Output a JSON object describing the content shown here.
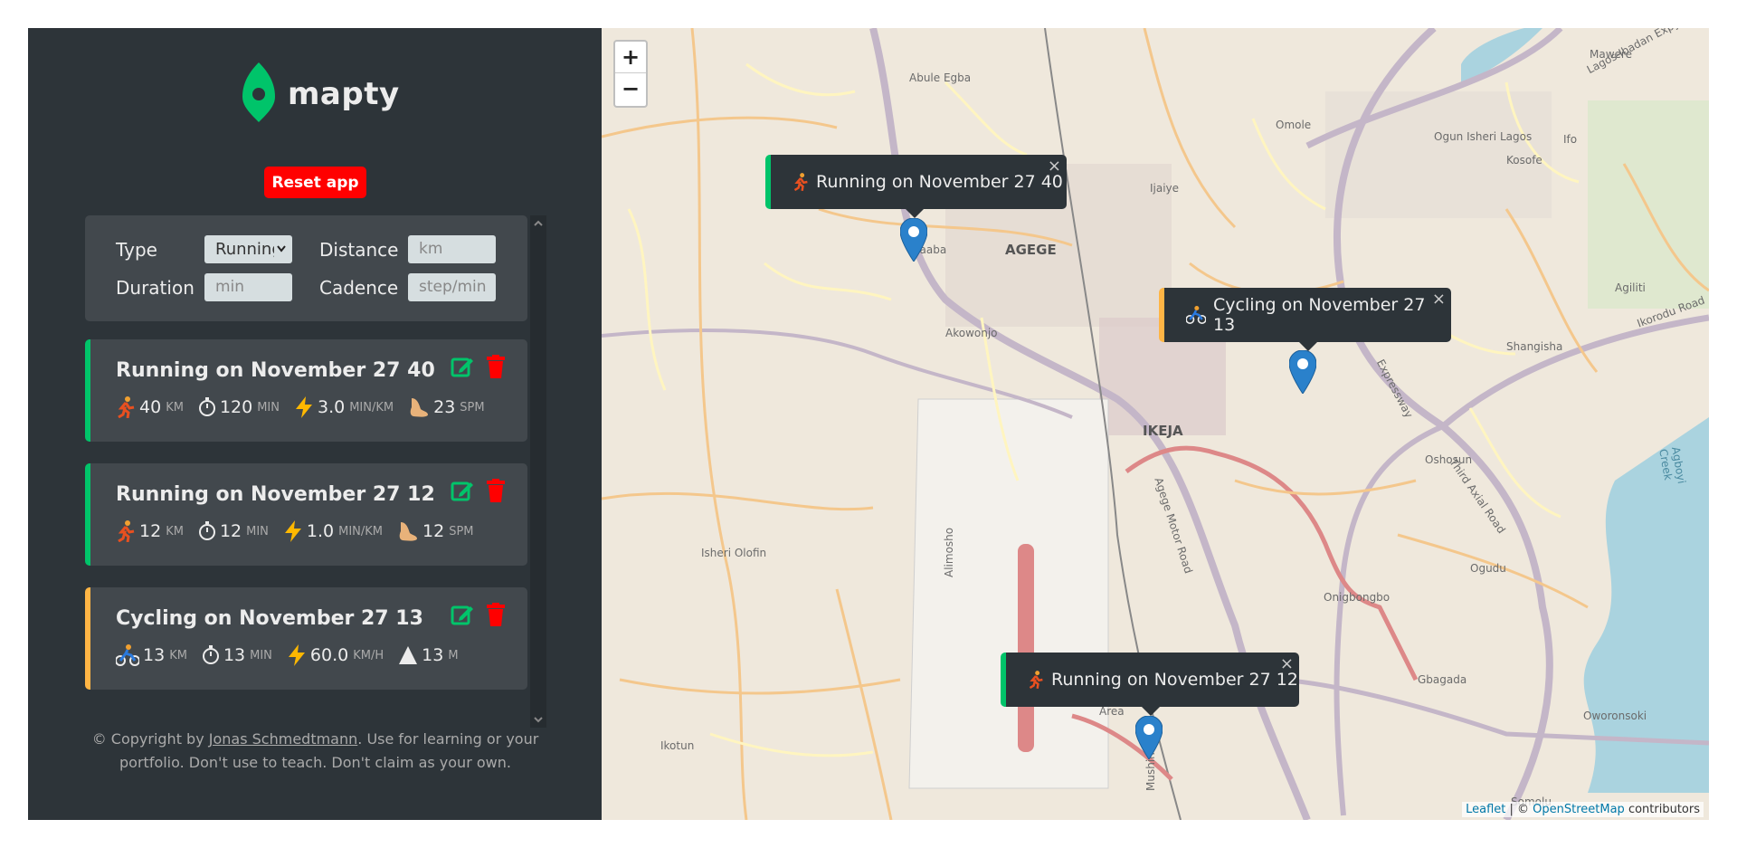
{
  "app": {
    "logo_text": "mapty",
    "reset_label": "Reset app",
    "colors": {
      "running": "#00c46a",
      "cycling": "#ffb545",
      "sidebar": "#2d3439",
      "card": "#42484d",
      "reset": "#ff0000"
    }
  },
  "form": {
    "type_label": "Type",
    "type_value": "Running",
    "distance_label": "Distance",
    "distance_placeholder": "km",
    "duration_label": "Duration",
    "duration_placeholder": "min",
    "cadence_label": "Cadence",
    "cadence_placeholder": "step/min"
  },
  "workouts": [
    {
      "type": "running",
      "title": "Running on November 27 40",
      "distance": "40",
      "distance_unit": "km",
      "duration": "120",
      "duration_unit": "min",
      "pace": "3.0",
      "pace_unit": "min/km",
      "cadence": "23",
      "cadence_unit": "spm"
    },
    {
      "type": "running",
      "title": "Running on November 27 12",
      "distance": "12",
      "distance_unit": "km",
      "duration": "12",
      "duration_unit": "min",
      "pace": "1.0",
      "pace_unit": "min/km",
      "cadence": "12",
      "cadence_unit": "spm"
    },
    {
      "type": "cycling",
      "title": "Cycling on November 27 13",
      "distance": "13",
      "distance_unit": "km",
      "duration": "13",
      "duration_unit": "min",
      "speed": "60.0",
      "speed_unit": "km/h",
      "elevation": "13",
      "elevation_unit": "m"
    }
  ],
  "copyright": {
    "prefix": "© Copyright by ",
    "author": "Jonas Schmedtmann",
    "suffix": ". Use for learning or your portfolio. Don't use to teach. Don't claim as your own."
  },
  "map": {
    "zoom_in": "+",
    "zoom_out": "−",
    "popups": [
      {
        "type": "running",
        "text": "Running on November 27 40"
      },
      {
        "type": "cycling",
        "text": "Cycling on November 27 13"
      },
      {
        "type": "running",
        "text": "Running on November 27 12"
      }
    ],
    "close_glyph": "×",
    "attribution": {
      "leaflet": "Leaflet",
      "sep": " | © ",
      "osm": "OpenStreetMap",
      "suffix": " contributors"
    },
    "labels": {
      "agege": "AGEGE",
      "ikeja": "IKEJA",
      "abule_egba": "Abule Egba",
      "omole": "Omole",
      "mawere": "Mawere",
      "ogun_isheri_lagos": "Ogun Isheri Lagos",
      "kosofe": "Kosofe",
      "ifo": "Ifo",
      "alaaba": "Alaaba",
      "akowonjo": "Akowonjo",
      "shangisha": "Shangisha",
      "oshosun": "Oshosun",
      "ojodu": "Ogudu",
      "onigbongbo": "Onigbongbo",
      "gbagada": "Gbagada",
      "oworonsoki": "Oworonsoki",
      "isheri_olofin": "Isheri Olofin",
      "ikotun": "Ikotun",
      "somolu": "Somolu",
      "mushin": "Mushin",
      "agiliti": "Agiliti",
      "ijaiye": "Ijaiye",
      "alimosho": "Alimosho",
      "area": "Area",
      "lagos_ibadan_expy": "Lagos-Ibadan Expy",
      "ikorodu_road": "Ikorodu Road",
      "third_axial_road": "Third Axial Road",
      "agege_motor_road": "Agege Motor Road",
      "expressway": "Expressway",
      "agboyi_creek": "Agboyi Creek"
    }
  }
}
